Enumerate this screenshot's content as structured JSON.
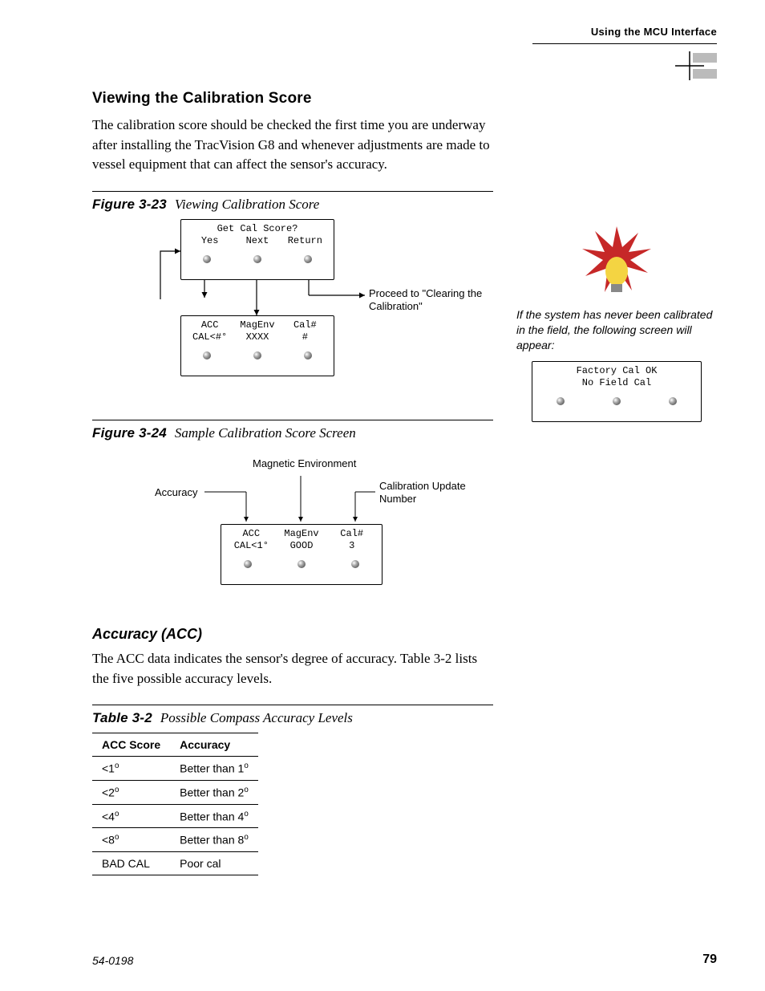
{
  "header": {
    "running": "Using the MCU Interface"
  },
  "section": {
    "title": "Viewing the Calibration Score",
    "para1": "The calibration score should be checked the first time you are underway after installing the TracVision G8 and whenever adjustments are made to vessel equipment that can affect the sensor's accuracy."
  },
  "fig23": {
    "label": "Figure 3-23",
    "title": "Viewing Calibration Score",
    "lcd1_row1": {
      "a": "Get Cal Score?",
      "b": "",
      "c": ""
    },
    "lcd1_row2": {
      "a": "Yes",
      "b": "Next",
      "c": "Return"
    },
    "lcd2_row1": {
      "a": "ACC",
      "b": "MagEnv",
      "c": "Cal#"
    },
    "lcd2_row2": {
      "a": "CAL<#°",
      "b": "XXXX",
      "c": "#"
    },
    "annot": "Proceed to \"Clearing the Calibration\""
  },
  "fig24": {
    "label": "Figure 3-24",
    "title": "Sample Calibration Score Screen",
    "top_left": "Accuracy",
    "top_mid": "Magnetic Environment",
    "top_right_l1": "Calibration Update",
    "top_right_l2": "Number",
    "lcd_row1": {
      "a": "ACC",
      "b": "MagEnv",
      "c": "Cal#"
    },
    "lcd_row2": {
      "a": "CAL<1°",
      "b": "GOOD",
      "c": "3"
    }
  },
  "acc": {
    "head": "Accuracy (ACC)",
    "para": "The ACC data indicates the sensor's degree of accuracy. Table 3-2 lists the five possible accuracy levels."
  },
  "table32": {
    "label": "Table 3-2",
    "title": "Possible Compass Accuracy Levels",
    "col1": "ACC Score",
    "col2": "Accuracy",
    "rows": [
      {
        "score_prefix": "<1",
        "acc_prefix": "Better than 1"
      },
      {
        "score_prefix": "<2",
        "acc_prefix": "Better than 2"
      },
      {
        "score_prefix": "<4",
        "acc_prefix": "Better than 4"
      },
      {
        "score_prefix": "<8",
        "acc_prefix": "Better than 8"
      },
      {
        "score_plain": "BAD CAL",
        "acc_plain": "Poor cal"
      }
    ]
  },
  "sidebar": {
    "tip": "If the system has never been calibrated in the field, the following screen will appear:",
    "lcd_row1": "Factory Cal OK",
    "lcd_row2": "No Field Cal"
  },
  "footer": {
    "left": "54-0198",
    "page": "79"
  }
}
